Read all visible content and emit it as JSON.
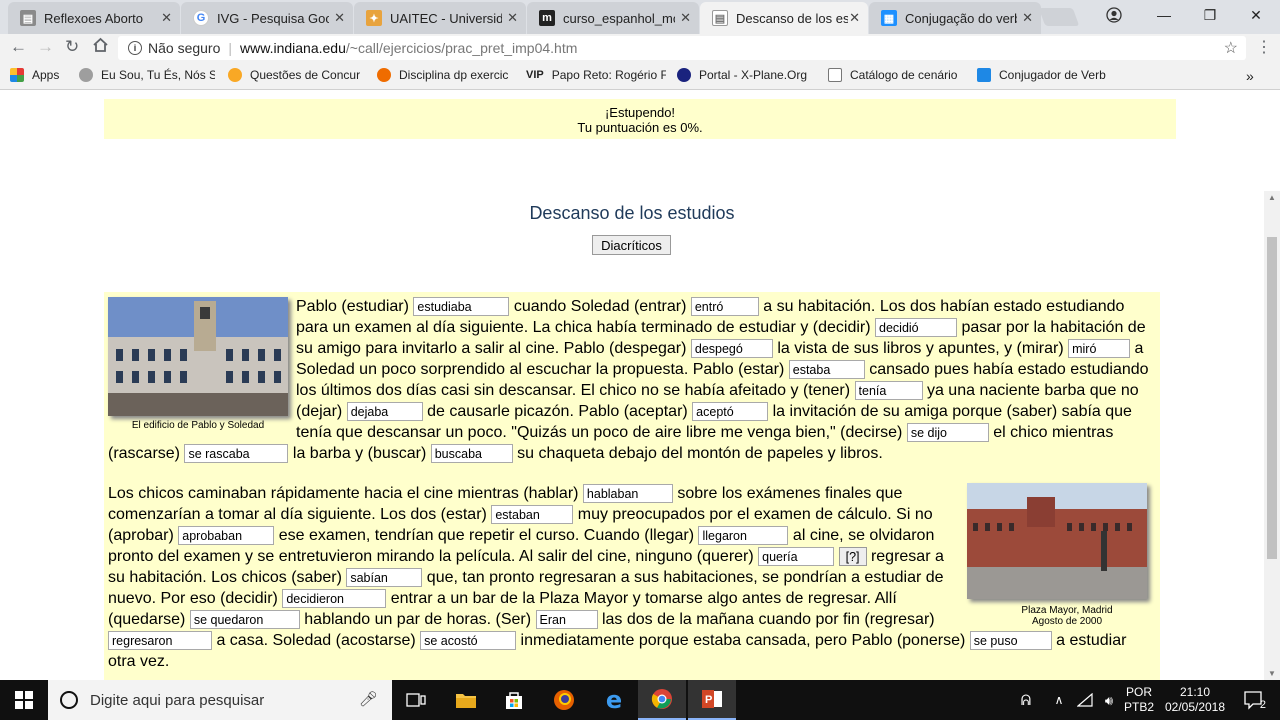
{
  "browser": {
    "tabs": [
      {
        "title": "Reflexoes Aborto",
        "fav": "#8a8a8a",
        "glyph": "▤"
      },
      {
        "title": "IVG - Pesquisa Googl",
        "fav": "#4285f4",
        "glyph": "G"
      },
      {
        "title": "UAITEC - Universidad",
        "fav": "#e8a33d",
        "glyph": "✦"
      },
      {
        "title": "curso_espanhol_mod",
        "fav": "#222222",
        "glyph": "m"
      },
      {
        "title": "Descanso de los estu",
        "fav": "#8a8a8a",
        "glyph": "▤",
        "active": true
      },
      {
        "title": "Conjugação do verbo",
        "fav": "#1e90ff",
        "glyph": "▦"
      }
    ],
    "url_prefix": "Não seguro",
    "url_domain": "www.indiana.edu",
    "url_path": "/~call/ejercicios/prac_pret_imp04.htm",
    "bookmarks": [
      {
        "label": "Apps",
        "color": "#e53935"
      },
      {
        "label": "Eu Sou, Tu És, Nós S",
        "color": "#9e9e9e"
      },
      {
        "label": "Questões de Concur",
        "color": "#f9a825"
      },
      {
        "label": "Disciplina dp exercic",
        "color": "#ef6c00"
      },
      {
        "label": "Papo Reto: Rogério F",
        "color": "#222222",
        "prefix": "VIP"
      },
      {
        "label": "Portal - X-Plane.Org",
        "color": "#1a237e"
      },
      {
        "label": "Catálogo de cenário",
        "color": "#9e9e9e"
      },
      {
        "label": "Conjugador de Verb",
        "color": "#1e88e5"
      }
    ],
    "more": "»"
  },
  "result": {
    "line1": "¡Estupendo!",
    "line2": "Tu puntuación es 0%."
  },
  "exercise": {
    "title": "Descanso de los estudios",
    "diacriticos": "Diacríticos",
    "photo1_caption": "El edificio de Pablo y Soledad",
    "photo2_caption_1": "Plaza Mayor, Madrid",
    "photo2_caption_2": "Agosto de 2000",
    "hint_label": "[?]",
    "p1": {
      "t0": "Pablo (estudiar) ",
      "a0": "estudiaba",
      "t1": " cuando Soledad (entrar) ",
      "a1": "entró",
      "t2": " a su habitación. Los dos habían estado estudiando para un examen al día siguiente. La chica había terminado de estudiar y (decidir) ",
      "a2": "decidió",
      "t3": " pasar por la habitación de su amigo para invitarlo a salir al cine. Pablo (despegar) ",
      "a3": "despegó",
      "t4": " la vista de sus libros y apuntes, y (mirar) ",
      "a4": "miró",
      "t5": " a Soledad un poco sorprendido al escuchar la propuesta. Pablo (estar) ",
      "a5": "estaba",
      "t6": " cansado pues había estado estudiando los últimos dos días casi sin descansar. El chico no se había afeitado y (tener) ",
      "a6": "tenía",
      "t7": " ya una naciente barba que no (dejar) ",
      "a7": "dejaba",
      "t8": " de causarle picazón. Pablo (aceptar) ",
      "a8": "aceptó",
      "t9": " la invitación de su amiga porque (saber) sabía que tenía que descansar un poco. \"Quizás un poco de aire libre me venga bien,\" (decirse) ",
      "a9": "se dijo",
      "t10": " el chico mientras (rascarse) ",
      "a10": "se rascaba",
      "t11": " la barba y (buscar) ",
      "a11": "buscaba",
      "t12": " su chaqueta debajo del montón de papeles y libros."
    },
    "p2": {
      "t0": "Los chicos caminaban rápidamente hacia el cine mientras (hablar) ",
      "a0": "hablaban",
      "t1": " sobre los exámenes finales que comenzarían a tomar al día siguiente. Los dos (estar) ",
      "a1": "estaban",
      "t2": " muy preocupados por el examen de cálculo. Si no (aprobar) ",
      "a2": "aprobaban",
      "t3": " ese examen, tendrían que repetir el curso. Cuando (llegar) ",
      "a3": "llegaron",
      "t4": " al cine, se olvidaron pronto del examen y se entretuvieron mirando la película. Al salir del cine, ninguno (querer) ",
      "a4": "quería",
      "t5": " regresar a su habitación. Los chicos (saber) ",
      "a5": "sabían",
      "t6": " que, tan pronto regresaran a sus habitaciones, se pondrían a estudiar de nuevo. Por eso (decidir) ",
      "a6": "decidieron",
      "t7": " entrar a un bar de la Plaza Mayor y tomarse algo antes de regresar. Allí (quedarse) ",
      "a7": "se quedaron",
      "t8": " hablando un par de horas. (Ser) ",
      "a8": "Eran",
      "t9": " las dos de la mañana cuando por fin (regresar) ",
      "a9": "regresaron",
      "t10": " a casa. Soledad (acostarse) ",
      "a10": "se acostó",
      "t11": " inmediatamente porque estaba cansada, pero Pablo (ponerse) ",
      "a11": "se puso",
      "t12": " a estudiar otra vez."
    }
  },
  "taskbar": {
    "search_placeholder": "Digite aqui para pesquisar",
    "lang1": "POR",
    "lang2": "PTB2",
    "time": "21:10",
    "date": "02/05/2018",
    "notif": "2"
  }
}
